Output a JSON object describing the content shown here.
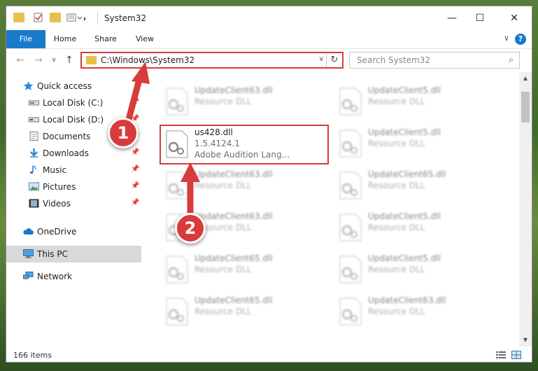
{
  "window": {
    "title": "System32",
    "minimize_glyph": "—",
    "maximize_glyph": "☐",
    "close_glyph": "✕"
  },
  "ribbon": {
    "tabs": [
      "File",
      "Home",
      "Share",
      "View"
    ],
    "help_label": "?",
    "collapse_glyph": "∨"
  },
  "nav": {
    "back_glyph": "←",
    "forward_glyph": "→",
    "recent_glyph": "∨",
    "up_glyph": "↑",
    "address": "C:\\Windows\\System32",
    "address_drop_glyph": "∨",
    "refresh_glyph": "↻",
    "search_placeholder": "Search System32",
    "search_glyph": "⌕"
  },
  "sidebar": {
    "items": [
      {
        "label": "Quick access",
        "icon": "star-icon"
      },
      {
        "label": "Local Disk (C:)",
        "icon": "drive-icon"
      },
      {
        "label": "Local Disk (D:)",
        "icon": "drive-icon"
      },
      {
        "label": "Documents",
        "icon": "documents-icon"
      },
      {
        "label": "Downloads",
        "icon": "download-icon"
      },
      {
        "label": "Music",
        "icon": "music-icon"
      },
      {
        "label": "Pictures",
        "icon": "pictures-icon"
      },
      {
        "label": "Videos",
        "icon": "videos-icon"
      },
      {
        "label": "OneDrive",
        "icon": "cloud-icon"
      },
      {
        "label": "This PC",
        "icon": "computer-icon"
      },
      {
        "label": "Network",
        "icon": "network-icon"
      }
    ],
    "pin_glyph": "📌"
  },
  "files": {
    "left_column": [
      {
        "name": "UpdateClient63.dll",
        "type": "Resource DLL"
      },
      {
        "name": "us428.dll",
        "version": "1.5.4124.1",
        "description": "Adobe Audition Lang..."
      },
      {
        "name": "UpdateClient63.dll",
        "type": "Resource DLL"
      },
      {
        "name": "UpdateClient63.dll",
        "type": "Resource DLL"
      },
      {
        "name": "UpdateClient65.dll",
        "type": "Resource DLL"
      },
      {
        "name": "UpdateClient65.dll",
        "type": "Resource DLL"
      }
    ],
    "right_column": [
      {
        "name": "UpdateClient5.dll",
        "type": "Resource DLL"
      },
      {
        "name": "UpdateClient5.dll",
        "type": "Resource DLL"
      },
      {
        "name": "UpdateClient65.dll",
        "type": "Resource DLL"
      },
      {
        "name": "UpdateClient5.dll",
        "type": "Resource DLL"
      },
      {
        "name": "UpdateClient5.dll",
        "type": "Resource DLL"
      },
      {
        "name": "UpdateClient63.dll",
        "type": "Resource DLL"
      }
    ]
  },
  "status": {
    "item_count": "166 items"
  },
  "callouts": {
    "first": "1",
    "second": "2"
  },
  "colors": {
    "accent": "#1979ca",
    "annotation_red": "#d83b3b",
    "folder_yellow": "#e8c04e"
  }
}
